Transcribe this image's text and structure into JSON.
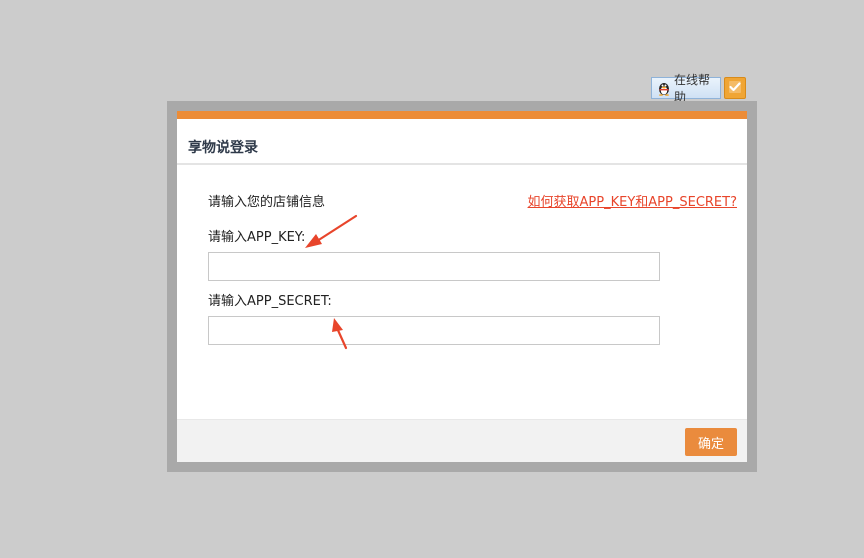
{
  "help_badge": {
    "label": "在线帮助",
    "icon": "qq-penguin-icon",
    "check_icon": "checkmark-icon"
  },
  "dialog": {
    "title": "享物说登录",
    "accent_color": "#ec8c37",
    "intro": "请输入您的店铺信息",
    "help_link": "如何获取APP_KEY和APP_SECRET?",
    "fields": [
      {
        "label": "请输入APP_KEY:",
        "value": "",
        "placeholder": ""
      },
      {
        "label": "请输入APP_SECRET:",
        "value": "",
        "placeholder": ""
      }
    ],
    "confirm_label": "确定",
    "annotation_color": "#e8452b"
  }
}
